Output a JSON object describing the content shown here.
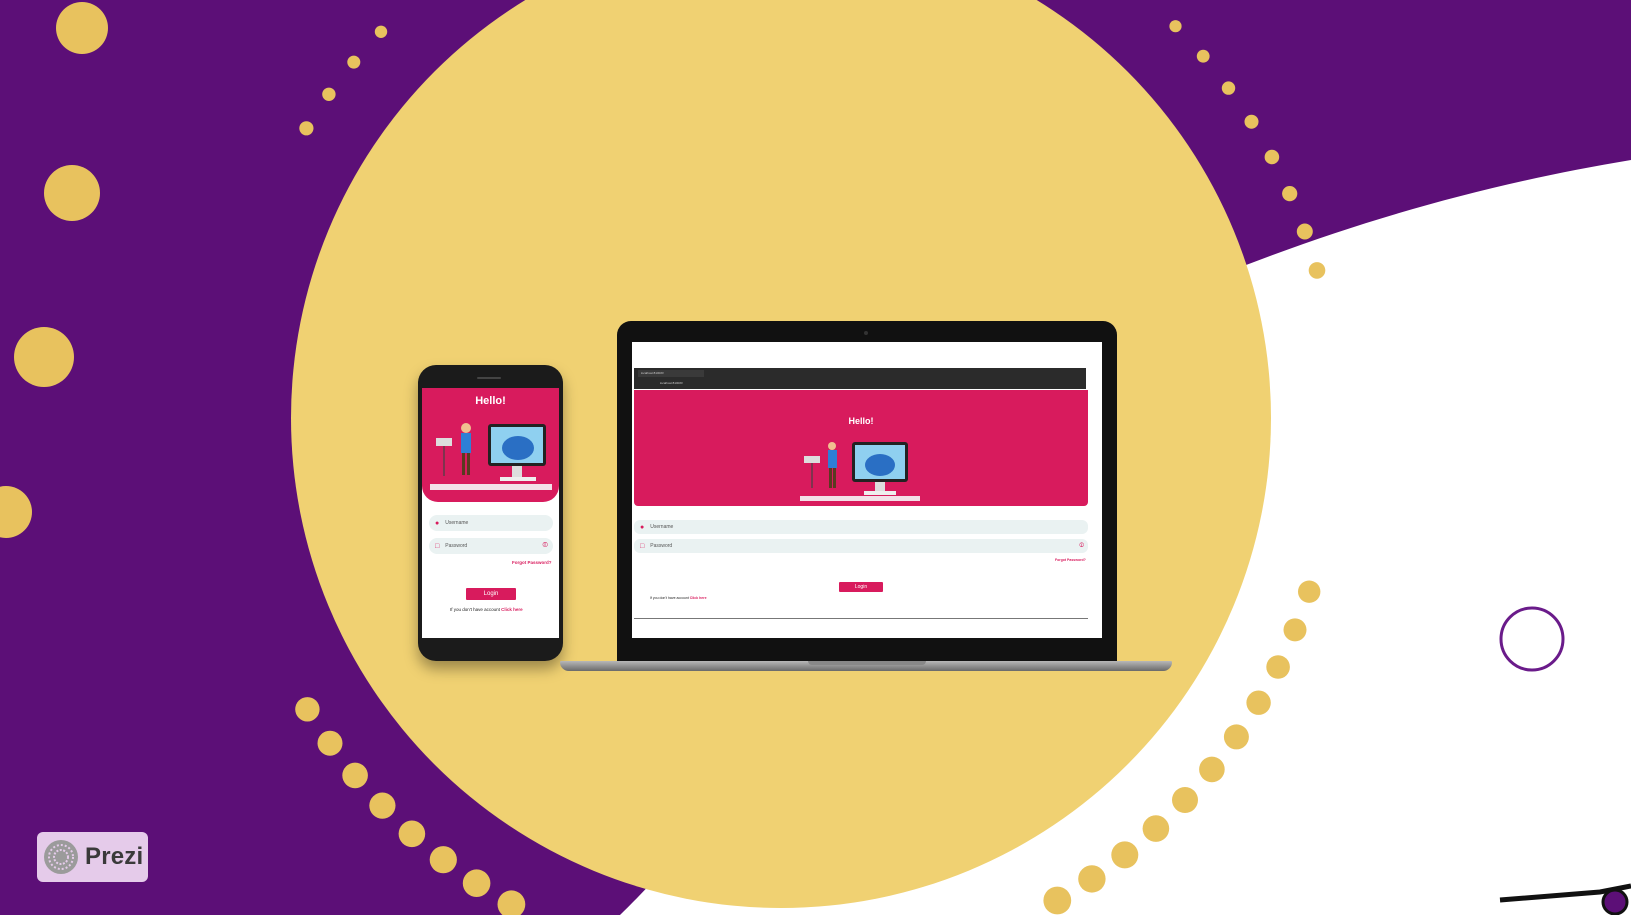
{
  "colors": {
    "background": "#5c0f77",
    "yellow": "#f0d172",
    "accent": "#d81b5d",
    "field": "#eaf2f2"
  },
  "badge": {
    "label": "Prezi",
    "icon": "prezi-logo-icon"
  },
  "phone": {
    "title": "Hello!",
    "username_placeholder": "Username",
    "password_placeholder": "Password",
    "forgot": "Forgot Password?",
    "login_label": "Login",
    "signup_text": "If you don't have account",
    "signup_link": "Click here",
    "icons": [
      "user-icon",
      "lock-icon",
      "eye-off-icon",
      "illustration-image"
    ]
  },
  "laptop": {
    "browser_tab": "localhost:8100/#/",
    "browser_url": "localhost:8100/#/",
    "title": "Hello!",
    "username_placeholder": "Username",
    "password_placeholder": "Password",
    "forgot": "Forgot Password?",
    "login_label": "Login",
    "signup_text": "If you don't have account",
    "signup_link": "Click here",
    "icons": [
      "user-icon",
      "lock-icon",
      "eye-off-icon",
      "illustration-image"
    ]
  }
}
